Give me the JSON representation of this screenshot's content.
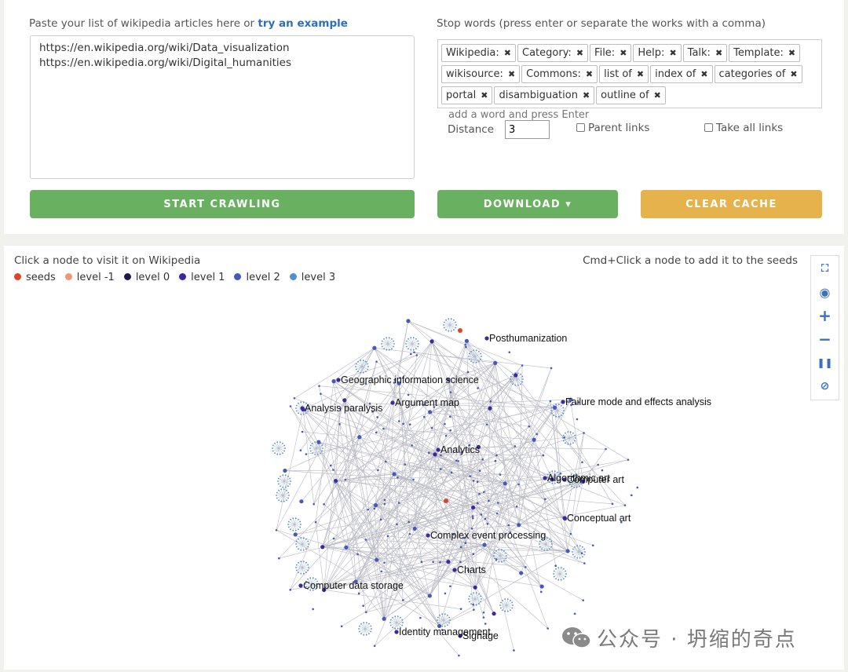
{
  "seeds": {
    "label": "Paste your list of wikipedia articles here or ",
    "example_link": "try an example",
    "value": "https://en.wikipedia.org/wiki/Data_visualization\nhttps://en.wikipedia.org/wiki/Digital_humanities"
  },
  "stopwords": {
    "label": "Stop words (press enter or separate the works with a comma)",
    "tags": [
      "Wikipedia:",
      "Category:",
      "File:",
      "Help:",
      "Talk:",
      "Template:",
      "wikisource:",
      "Commons:",
      "list of",
      "index of",
      "categories of",
      "portal",
      "disambiguation",
      "outline of"
    ],
    "placeholder": "add a word and press Enter"
  },
  "options": {
    "distance_label": "Distance",
    "distance_value": "3",
    "parent_links": "Parent links",
    "take_all_links": "Take all links"
  },
  "buttons": {
    "start": "START CRAWLING",
    "download": "DOWNLOAD ▾",
    "clear": "CLEAR CACHE"
  },
  "graph": {
    "hint_left": "Click a node to visit it on Wikipedia",
    "hint_right": "Cmd+Click a node to add it to the seeds",
    "legend": [
      {
        "label": "seeds",
        "color": "#d9472b"
      },
      {
        "label": "level -1",
        "color": "#f0967a"
      },
      {
        "label": "level 0",
        "color": "#1c1a4d"
      },
      {
        "label": "level 1",
        "color": "#3a2a9b"
      },
      {
        "label": "level 2",
        "color": "#4658b8"
      },
      {
        "label": "level 3",
        "color": "#4f8fcf"
      }
    ],
    "node_labels": [
      "Posthumanization",
      "Geographic information science",
      "Argument map",
      "Analysis paralysis",
      "Failure mode and effects analysis",
      "Analytics",
      "Algorithmic art",
      "Computer art",
      "Conceptual art",
      "Complex event processing",
      "Charts",
      "Computer data storage",
      "Identity management",
      "Signage"
    ],
    "tools": [
      "fullscreen-icon",
      "locate-icon",
      "zoom-in-icon",
      "zoom-out-icon",
      "pause-icon",
      "hide-icon"
    ]
  },
  "watermark": "公众号 · 坍缩的奇点"
}
